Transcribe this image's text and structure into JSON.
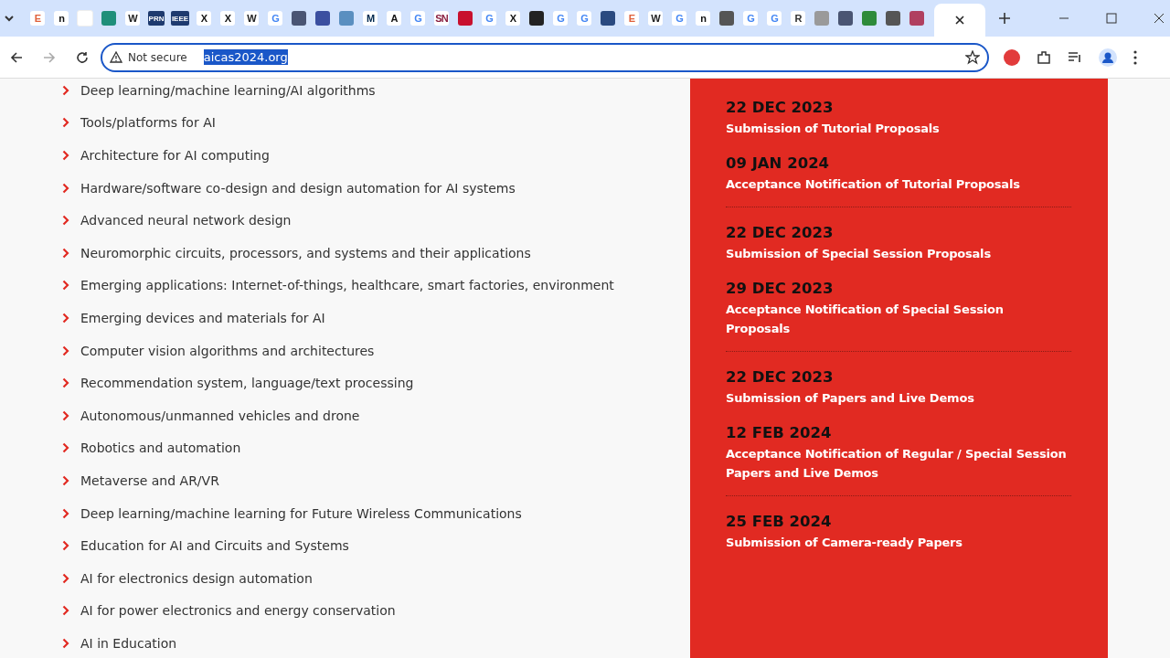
{
  "browser": {
    "tabs": [
      {
        "kind": "letter",
        "glyph": "E",
        "color": "#e0603a",
        "selected": false
      },
      {
        "kind": "letter",
        "glyph": "n",
        "color": "#111111",
        "selected": false
      },
      {
        "kind": "shape",
        "color": "#ffffff",
        "selected": false
      },
      {
        "kind": "shape",
        "color": "#1f8f7a",
        "selected": false
      },
      {
        "kind": "letter",
        "glyph": "W",
        "color": "#222222",
        "selected": false
      },
      {
        "kind": "letter",
        "glyph": "PRN",
        "color": "#1e3a6e",
        "selected": false
      },
      {
        "kind": "letter",
        "glyph": "IEEE",
        "color": "#1e3a6e",
        "selected": false
      },
      {
        "kind": "letter",
        "glyph": "X",
        "color": "#111111",
        "selected": false
      },
      {
        "kind": "letter",
        "glyph": "X",
        "color": "#111111",
        "selected": false
      },
      {
        "kind": "letter",
        "glyph": "W",
        "color": "#222222",
        "selected": false
      },
      {
        "kind": "letter",
        "glyph": "G",
        "color": "#4285f4",
        "selected": false
      },
      {
        "kind": "shape",
        "color": "#4a5573",
        "selected": false
      },
      {
        "kind": "shape",
        "color": "#3b4fa0",
        "selected": false
      },
      {
        "kind": "shape",
        "color": "#5a8fc0",
        "selected": false
      },
      {
        "kind": "letter",
        "glyph": "M",
        "color": "#00274c",
        "selected": false
      },
      {
        "kind": "letter",
        "glyph": "A",
        "color": "#111111",
        "selected": false
      },
      {
        "kind": "letter",
        "glyph": "G",
        "color": "#4285f4",
        "selected": false
      },
      {
        "kind": "letter",
        "glyph": "SN",
        "color": "#8a2040",
        "selected": false
      },
      {
        "kind": "shape",
        "color": "#c8102e",
        "selected": false
      },
      {
        "kind": "letter",
        "glyph": "G",
        "color": "#4285f4",
        "selected": false
      },
      {
        "kind": "letter",
        "glyph": "X",
        "color": "#111111",
        "selected": false
      },
      {
        "kind": "shape",
        "color": "#222222",
        "selected": false
      },
      {
        "kind": "letter",
        "glyph": "G",
        "color": "#4285f4",
        "selected": false
      },
      {
        "kind": "letter",
        "glyph": "G",
        "color": "#4285f4",
        "selected": false
      },
      {
        "kind": "shape",
        "color": "#2a4a80",
        "selected": false
      },
      {
        "kind": "letter",
        "glyph": "E",
        "color": "#e0603a",
        "selected": false
      },
      {
        "kind": "letter",
        "glyph": "W",
        "color": "#222222",
        "selected": false
      },
      {
        "kind": "letter",
        "glyph": "G",
        "color": "#4285f4",
        "selected": false
      },
      {
        "kind": "letter",
        "glyph": "n",
        "color": "#111111",
        "selected": false
      },
      {
        "kind": "shape",
        "color": "#555555",
        "selected": false
      },
      {
        "kind": "letter",
        "glyph": "G",
        "color": "#4285f4",
        "selected": false
      },
      {
        "kind": "letter",
        "glyph": "G",
        "color": "#4285f4",
        "selected": false
      },
      {
        "kind": "letter",
        "glyph": "R",
        "color": "#333333",
        "selected": false
      },
      {
        "kind": "shape",
        "color": "#9a9a9a",
        "selected": false
      },
      {
        "kind": "shape",
        "color": "#4a5573",
        "selected": false
      },
      {
        "kind": "shape",
        "color": "#2e8b3a",
        "selected": false
      },
      {
        "kind": "shape",
        "color": "#555555",
        "selected": false
      },
      {
        "kind": "shape",
        "color": "#b04060",
        "selected": false
      },
      {
        "kind": "active",
        "selected": true
      }
    ],
    "security": "Not secure",
    "url": "aicas2024.org",
    "url_selected": true
  },
  "topics": [
    "Deep learning/machine learning/AI algorithms",
    "Tools/platforms for AI",
    "Architecture for AI computing",
    "Hardware/software co-design and design automation for AI systems",
    "Advanced neural network design",
    "Neuromorphic circuits, processors, and systems and their applications",
    "Emerging applications: Internet-of-things, healthcare, smart factories, environment",
    "Emerging devices and materials for AI",
    "Computer vision algorithms and architectures",
    "Recommendation system, language/text processing",
    "Autonomous/unmanned vehicles and drone",
    "Robotics and automation",
    "Metaverse and AR/VR",
    "Deep learning/machine learning for Future Wireless Communications",
    "Education for AI and Circuits and Systems",
    "AI for electronics design automation",
    "AI for power electronics and energy conservation",
    "AI in Education"
  ],
  "deadline_groups": [
    [
      {
        "date": "22 DEC 2023",
        "event": "Submission of Tutorial Proposals"
      },
      {
        "date": "09 JAN 2024",
        "event": "Acceptance Notification of Tutorial Proposals"
      }
    ],
    [
      {
        "date": "22 DEC 2023",
        "event": "Submission of Special Session Proposals"
      },
      {
        "date": "29 DEC 2023",
        "event": "Acceptance Notification of Special Session Proposals"
      }
    ],
    [
      {
        "date": "22 DEC 2023",
        "event": "Submission of Papers and Live Demos"
      },
      {
        "date": "12 FEB 2024",
        "event": "Acceptance Notification of Regular / Special Session Papers and Live Demos"
      }
    ],
    [
      {
        "date": "25 FEB 2024",
        "event": "Submission of Camera-ready Papers"
      }
    ]
  ]
}
